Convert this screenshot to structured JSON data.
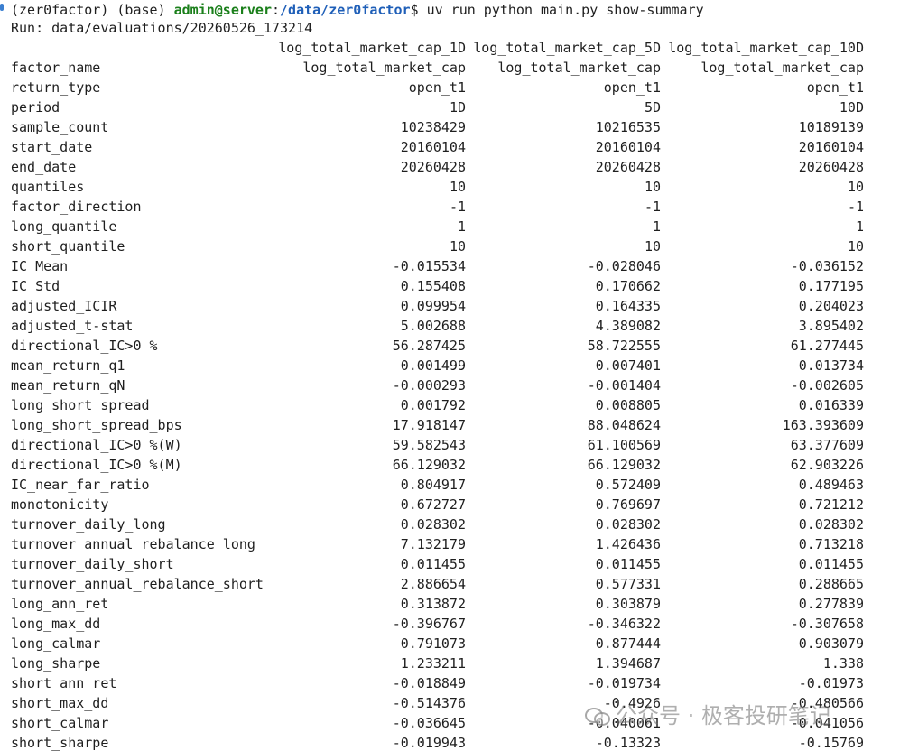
{
  "terminal": {
    "env": "(zer0factor) (base) ",
    "user_host": "admin@server",
    "path_sep": ":",
    "path": "/data/zer0factor",
    "prompt_char": "$ ",
    "command": "uv run python main.py show-summary",
    "run_line": "Run: data/evaluations/20260526_173214"
  },
  "table": {
    "columns": [
      "log_total_market_cap_1D",
      "log_total_market_cap_5D",
      "log_total_market_cap_10D"
    ],
    "rows": [
      {
        "label": "factor_name",
        "values": [
          "log_total_market_cap",
          "log_total_market_cap",
          "log_total_market_cap"
        ]
      },
      {
        "label": "return_type",
        "values": [
          "open_t1",
          "open_t1",
          "open_t1"
        ]
      },
      {
        "label": "period",
        "values": [
          "1D",
          "5D",
          "10D"
        ]
      },
      {
        "label": "sample_count",
        "values": [
          "10238429",
          "10216535",
          "10189139"
        ]
      },
      {
        "label": "start_date",
        "values": [
          "20160104",
          "20160104",
          "20160104"
        ]
      },
      {
        "label": "end_date",
        "values": [
          "20260428",
          "20260428",
          "20260428"
        ]
      },
      {
        "label": "quantiles",
        "values": [
          "10",
          "10",
          "10"
        ]
      },
      {
        "label": "factor_direction",
        "values": [
          "-1",
          "-1",
          "-1"
        ]
      },
      {
        "label": "long_quantile",
        "values": [
          "1",
          "1",
          "1"
        ]
      },
      {
        "label": "short_quantile",
        "values": [
          "10",
          "10",
          "10"
        ]
      },
      {
        "label": "IC Mean",
        "values": [
          "-0.015534",
          "-0.028046",
          "-0.036152"
        ]
      },
      {
        "label": "IC Std",
        "values": [
          "0.155408",
          "0.170662",
          "0.177195"
        ]
      },
      {
        "label": "adjusted_ICIR",
        "values": [
          "0.099954",
          "0.164335",
          "0.204023"
        ]
      },
      {
        "label": "adjusted_t-stat",
        "values": [
          "5.002688",
          "4.389082",
          "3.895402"
        ]
      },
      {
        "label": "directional_IC>0 %",
        "values": [
          "56.287425",
          "58.722555",
          "61.277445"
        ]
      },
      {
        "label": "mean_return_q1",
        "values": [
          "0.001499",
          "0.007401",
          "0.013734"
        ]
      },
      {
        "label": "mean_return_qN",
        "values": [
          "-0.000293",
          "-0.001404",
          "-0.002605"
        ]
      },
      {
        "label": "long_short_spread",
        "values": [
          "0.001792",
          "0.008805",
          "0.016339"
        ]
      },
      {
        "label": "long_short_spread_bps",
        "values": [
          "17.918147",
          "88.048624",
          "163.393609"
        ]
      },
      {
        "label": "directional_IC>0 %(W)",
        "values": [
          "59.582543",
          "61.100569",
          "63.377609"
        ]
      },
      {
        "label": "directional_IC>0 %(M)",
        "values": [
          "66.129032",
          "66.129032",
          "62.903226"
        ]
      },
      {
        "label": "IC_near_far_ratio",
        "values": [
          "0.804917",
          "0.572409",
          "0.489463"
        ]
      },
      {
        "label": "monotonicity",
        "values": [
          "0.672727",
          "0.769697",
          "0.721212"
        ]
      },
      {
        "label": "turnover_daily_long",
        "values": [
          "0.028302",
          "0.028302",
          "0.028302"
        ]
      },
      {
        "label": "turnover_annual_rebalance_long",
        "values": [
          "7.132179",
          "1.426436",
          "0.713218"
        ]
      },
      {
        "label": "turnover_daily_short",
        "values": [
          "0.011455",
          "0.011455",
          "0.011455"
        ]
      },
      {
        "label": "turnover_annual_rebalance_short",
        "values": [
          "2.886654",
          "0.577331",
          "0.288665"
        ]
      },
      {
        "label": "long_ann_ret",
        "values": [
          "0.313872",
          "0.303879",
          "0.277839"
        ]
      },
      {
        "label": "long_max_dd",
        "values": [
          "-0.396767",
          "-0.346322",
          "-0.307658"
        ]
      },
      {
        "label": "long_calmar",
        "values": [
          "0.791073",
          "0.877444",
          "0.903079"
        ]
      },
      {
        "label": "long_sharpe",
        "values": [
          "1.233211",
          "1.394687",
          "1.338"
        ]
      },
      {
        "label": "short_ann_ret",
        "values": [
          "-0.018849",
          "-0.019734",
          "-0.01973"
        ]
      },
      {
        "label": "short_max_dd",
        "values": [
          "-0.514376",
          "-0.4926",
          "-0.480566"
        ]
      },
      {
        "label": "short_calmar",
        "values": [
          "-0.036645",
          "-0.040061",
          "-0.041056"
        ]
      },
      {
        "label": "short_sharpe",
        "values": [
          "-0.019943",
          "-0.13323",
          "-0.15769"
        ]
      }
    ]
  },
  "watermark": {
    "text": "公众号 · 极客投研笔记",
    "icon": "wechat-bubbles-icon"
  },
  "colors": {
    "user_host": "#1a7f1a",
    "path": "#1f5fb8",
    "gutter_mark": "#3b7fd0"
  }
}
